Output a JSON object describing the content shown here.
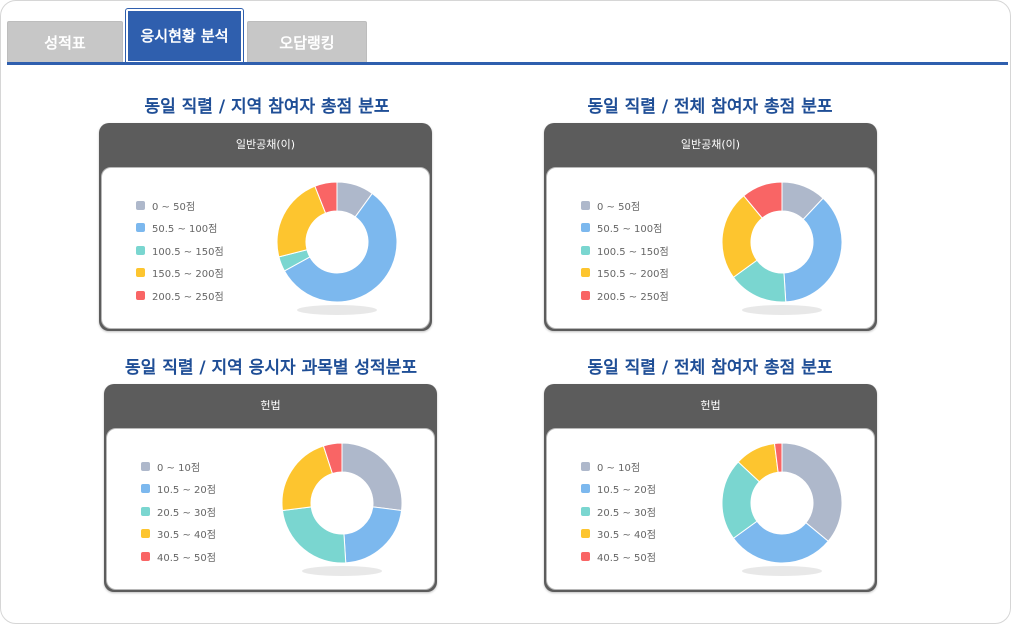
{
  "tabs": [
    {
      "label": "성적표",
      "active": false
    },
    {
      "label": "응시현황 분석",
      "active": true
    },
    {
      "label": "오답랭킹",
      "active": false
    }
  ],
  "colors": {
    "accent": "#2f5fae",
    "title": "#1f4e96",
    "card_header": "#5c5c5c"
  },
  "panels": [
    {
      "title": "동일 직렬 / 지역 참여자 총점 분포",
      "header": "일반공채(이)",
      "legend": [
        "0 ~ 50점",
        "50.5 ~ 100점",
        "100.5 ~ 150점",
        "150.5 ~ 200점",
        "200.5 ~ 250점"
      ],
      "chart_data": {
        "type": "pie",
        "donut": true,
        "categories": [
          "0 ~ 50점",
          "50.5 ~ 100점",
          "100.5 ~ 150점",
          "150.5 ~ 200점",
          "200.5 ~ 250점"
        ],
        "values": [
          10,
          57,
          4,
          23,
          6
        ]
      }
    },
    {
      "title": "동일 직렬 / 전체 참여자 총점 분포",
      "header": "일반공채(이)",
      "legend": [
        "0 ~ 50점",
        "50.5 ~ 100점",
        "100.5 ~ 150점",
        "150.5 ~ 200점",
        "200.5 ~ 250점"
      ],
      "chart_data": {
        "type": "pie",
        "donut": true,
        "categories": [
          "0 ~ 50점",
          "50.5 ~ 100점",
          "100.5 ~ 150점",
          "150.5 ~ 200점",
          "200.5 ~ 250점"
        ],
        "values": [
          12,
          37,
          16,
          24,
          11
        ]
      }
    },
    {
      "title": "동일 직렬 / 지역 응시자 과목별 성적분포",
      "header": "헌법",
      "legend": [
        "0 ~ 10점",
        "10.5 ~ 20점",
        "20.5 ~ 30점",
        "30.5 ~ 40점",
        "40.5 ~ 50점"
      ],
      "chart_data": {
        "type": "pie",
        "donut": true,
        "categories": [
          "0 ~ 10점",
          "10.5 ~ 20점",
          "20.5 ~ 30점",
          "30.5 ~ 40점",
          "40.5 ~ 50점"
        ],
        "values": [
          27,
          22,
          24,
          22,
          5
        ]
      }
    },
    {
      "title": "동일 직렬 / 전체 참여자 총점 분포",
      "header": "헌법",
      "legend": [
        "0 ~ 10점",
        "10.5 ~ 20점",
        "20.5 ~ 30점",
        "30.5 ~ 40점",
        "40.5 ~ 50점"
      ],
      "chart_data": {
        "type": "pie",
        "donut": true,
        "categories": [
          "0 ~ 10점",
          "10.5 ~ 20점",
          "20.5 ~ 30점",
          "30.5 ~ 40점",
          "40.5 ~ 50점"
        ],
        "values": [
          36,
          29,
          22,
          11,
          2
        ]
      }
    }
  ],
  "series_colors": [
    "#aeb8cb",
    "#7cb8ee",
    "#7ad6d0",
    "#fdc52f",
    "#f96565"
  ]
}
